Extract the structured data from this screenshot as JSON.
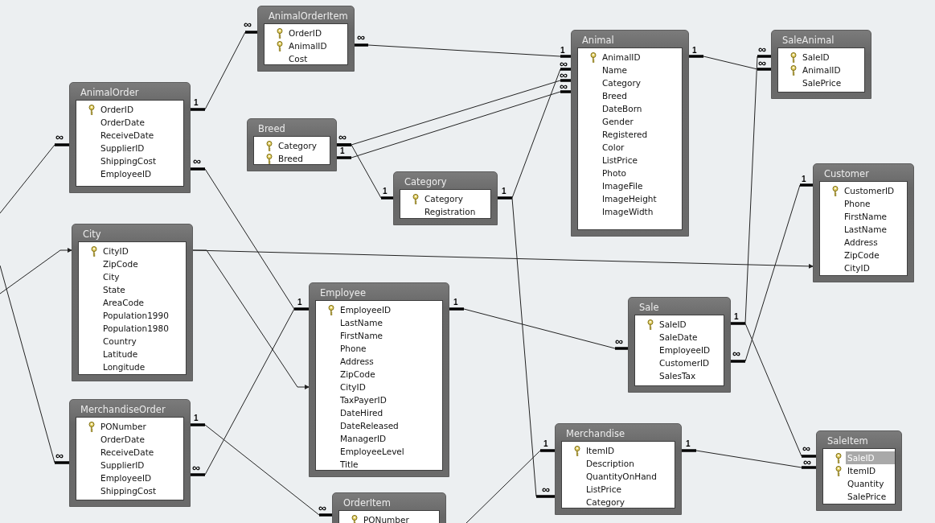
{
  "tables": [
    {
      "title": "AnimalOrderItem",
      "fields": [
        {
          "name": "OrderID",
          "key": true,
          "selected": false
        },
        {
          "name": "AnimalID",
          "key": true,
          "selected": false
        },
        {
          "name": "Cost",
          "key": false,
          "selected": false
        }
      ]
    },
    {
      "title": "Animal",
      "fields": [
        {
          "name": "AnimalID",
          "key": true,
          "selected": false
        },
        {
          "name": "Name",
          "key": false,
          "selected": false
        },
        {
          "name": "Category",
          "key": false,
          "selected": false
        },
        {
          "name": "Breed",
          "key": false,
          "selected": false
        },
        {
          "name": "DateBorn",
          "key": false,
          "selected": false
        },
        {
          "name": "Gender",
          "key": false,
          "selected": false
        },
        {
          "name": "Registered",
          "key": false,
          "selected": false
        },
        {
          "name": "Color",
          "key": false,
          "selected": false
        },
        {
          "name": "ListPrice",
          "key": false,
          "selected": false
        },
        {
          "name": "Photo",
          "key": false,
          "selected": false
        },
        {
          "name": "ImageFile",
          "key": false,
          "selected": false
        },
        {
          "name": "ImageHeight",
          "key": false,
          "selected": false
        },
        {
          "name": "ImageWidth",
          "key": false,
          "selected": false
        }
      ]
    },
    {
      "title": "SaleAnimal",
      "fields": [
        {
          "name": "SaleID",
          "key": true,
          "selected": false
        },
        {
          "name": "AnimalID",
          "key": true,
          "selected": false
        },
        {
          "name": "SalePrice",
          "key": false,
          "selected": false
        }
      ]
    },
    {
      "title": "AnimalOrder",
      "fields": [
        {
          "name": "OrderID",
          "key": true,
          "selected": false
        },
        {
          "name": "OrderDate",
          "key": false,
          "selected": false
        },
        {
          "name": "ReceiveDate",
          "key": false,
          "selected": false
        },
        {
          "name": "SupplierID",
          "key": false,
          "selected": false
        },
        {
          "name": "ShippingCost",
          "key": false,
          "selected": false
        },
        {
          "name": "EmployeeID",
          "key": false,
          "selected": false
        }
      ]
    },
    {
      "title": "Breed",
      "fields": [
        {
          "name": "Category",
          "key": true,
          "selected": false
        },
        {
          "name": "Breed",
          "key": true,
          "selected": false
        }
      ]
    },
    {
      "title": "Category",
      "fields": [
        {
          "name": "Category",
          "key": true,
          "selected": false
        },
        {
          "name": "Registration",
          "key": false,
          "selected": false
        }
      ]
    },
    {
      "title": "Customer",
      "fields": [
        {
          "name": "CustomerID",
          "key": true,
          "selected": false
        },
        {
          "name": "Phone",
          "key": false,
          "selected": false
        },
        {
          "name": "FirstName",
          "key": false,
          "selected": false
        },
        {
          "name": "LastName",
          "key": false,
          "selected": false
        },
        {
          "name": "Address",
          "key": false,
          "selected": false
        },
        {
          "name": "ZipCode",
          "key": false,
          "selected": false
        },
        {
          "name": "CityID",
          "key": false,
          "selected": false
        }
      ]
    },
    {
      "title": "City",
      "fields": [
        {
          "name": "CityID",
          "key": true,
          "selected": false
        },
        {
          "name": "ZipCode",
          "key": false,
          "selected": false
        },
        {
          "name": "City",
          "key": false,
          "selected": false
        },
        {
          "name": "State",
          "key": false,
          "selected": false
        },
        {
          "name": "AreaCode",
          "key": false,
          "selected": false
        },
        {
          "name": "Population1990",
          "key": false,
          "selected": false
        },
        {
          "name": "Population1980",
          "key": false,
          "selected": false
        },
        {
          "name": "Country",
          "key": false,
          "selected": false
        },
        {
          "name": "Latitude",
          "key": false,
          "selected": false
        },
        {
          "name": "Longitude",
          "key": false,
          "selected": false
        }
      ]
    },
    {
      "title": "Employee",
      "fields": [
        {
          "name": "EmployeeID",
          "key": true,
          "selected": false
        },
        {
          "name": "LastName",
          "key": false,
          "selected": false
        },
        {
          "name": "FirstName",
          "key": false,
          "selected": false
        },
        {
          "name": "Phone",
          "key": false,
          "selected": false
        },
        {
          "name": "Address",
          "key": false,
          "selected": false
        },
        {
          "name": "ZipCode",
          "key": false,
          "selected": false
        },
        {
          "name": "CityID",
          "key": false,
          "selected": false
        },
        {
          "name": "TaxPayerID",
          "key": false,
          "selected": false
        },
        {
          "name": "DateHired",
          "key": false,
          "selected": false
        },
        {
          "name": "DateReleased",
          "key": false,
          "selected": false
        },
        {
          "name": "ManagerID",
          "key": false,
          "selected": false
        },
        {
          "name": "EmployeeLevel",
          "key": false,
          "selected": false
        },
        {
          "name": "Title",
          "key": false,
          "selected": false
        }
      ]
    },
    {
      "title": "Sale",
      "fields": [
        {
          "name": "SaleID",
          "key": true,
          "selected": false
        },
        {
          "name": "SaleDate",
          "key": false,
          "selected": false
        },
        {
          "name": "EmployeeID",
          "key": false,
          "selected": false
        },
        {
          "name": "CustomerID",
          "key": false,
          "selected": false
        },
        {
          "name": "SalesTax",
          "key": false,
          "selected": false
        }
      ]
    },
    {
      "title": "MerchandiseOrder",
      "fields": [
        {
          "name": "PONumber",
          "key": true,
          "selected": false
        },
        {
          "name": "OrderDate",
          "key": false,
          "selected": false
        },
        {
          "name": "ReceiveDate",
          "key": false,
          "selected": false
        },
        {
          "name": "SupplierID",
          "key": false,
          "selected": false
        },
        {
          "name": "EmployeeID",
          "key": false,
          "selected": false
        },
        {
          "name": "ShippingCost",
          "key": false,
          "selected": false
        }
      ]
    },
    {
      "title": "Merchandise",
      "fields": [
        {
          "name": "ItemID",
          "key": true,
          "selected": false
        },
        {
          "name": "Description",
          "key": false,
          "selected": false
        },
        {
          "name": "QuantityOnHand",
          "key": false,
          "selected": false
        },
        {
          "name": "ListPrice",
          "key": false,
          "selected": false
        },
        {
          "name": "Category",
          "key": false,
          "selected": false
        }
      ]
    },
    {
      "title": "SaleItem",
      "fields": [
        {
          "name": "SaleID",
          "key": true,
          "selected": true
        },
        {
          "name": "ItemID",
          "key": true,
          "selected": false
        },
        {
          "name": "Quantity",
          "key": false,
          "selected": false
        },
        {
          "name": "SalePrice",
          "key": false,
          "selected": false
        }
      ]
    },
    {
      "title": "OrderItem",
      "fields": [
        {
          "name": "PONumber",
          "key": true,
          "selected": false
        }
      ]
    }
  ],
  "relationships": [
    {
      "kind": "marks",
      "labels": [
        "1",
        "∞"
      ]
    },
    {
      "kind": "marks",
      "labels": [
        "∞",
        "1"
      ]
    },
    {
      "kind": "marks",
      "labels": [
        "1",
        "∞"
      ]
    },
    {
      "kind": "marks",
      "labels": [
        "1",
        "∞"
      ]
    },
    {
      "kind": "marks",
      "labels": [
        "1",
        "∞",
        "∞"
      ]
    },
    {
      "kind": "marks",
      "labels": [
        "1",
        "∞"
      ]
    },
    {
      "kind": "marks",
      "labels": [
        "1",
        "∞"
      ]
    },
    {
      "kind": "marks",
      "labels": [
        "∞"
      ]
    },
    {
      "kind": "marks",
      "labels": [
        "1",
        "∞"
      ]
    },
    {
      "kind": "arrow"
    },
    {
      "kind": "marks",
      "labels": [
        "1",
        "∞"
      ]
    },
    {
      "kind": "marks",
      "labels": [
        "∞"
      ]
    },
    {
      "kind": "marks",
      "labels": [
        "1",
        "∞"
      ]
    },
    {
      "kind": "marks",
      "labels": [
        "∞",
        "1"
      ]
    },
    {
      "kind": "arrow"
    },
    {
      "kind": "marks",
      "labels": [
        "1",
        "∞"
      ]
    },
    {
      "kind": "marks",
      "labels": [
        "∞"
      ]
    },
    {
      "kind": "marks",
      "labels": [
        "1"
      ]
    },
    {
      "kind": "marks",
      "labels": [
        "∞"
      ]
    },
    {
      "kind": "arrow"
    },
    {
      "kind": "marks",
      "labels": [
        "∞"
      ]
    }
  ]
}
